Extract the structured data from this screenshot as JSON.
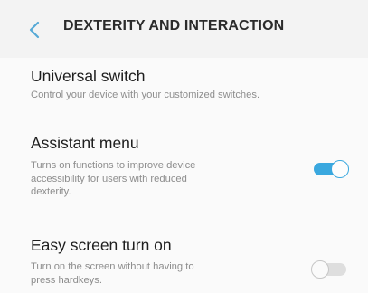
{
  "header": {
    "back_icon": "chevron-left-icon",
    "title": "DEXTERITY AND INTERACTION"
  },
  "items": [
    {
      "title": "Universal switch",
      "subtitle": "Control your device with your customized switches."
    },
    {
      "title": "Assistant menu",
      "subtitle_lines": [
        "Turns on functions to improve device",
        "accessibility for users with reduced",
        "dexterity."
      ],
      "toggle": "on"
    },
    {
      "title": "Easy screen turn on",
      "subtitle_lines": [
        "Turn on the screen without having to",
        "press hardkeys."
      ],
      "toggle": "off"
    }
  ],
  "colors": {
    "accent": "#3aa8df",
    "title_text": "#1e1e1e",
    "secondary_text": "#8d8d8d"
  }
}
